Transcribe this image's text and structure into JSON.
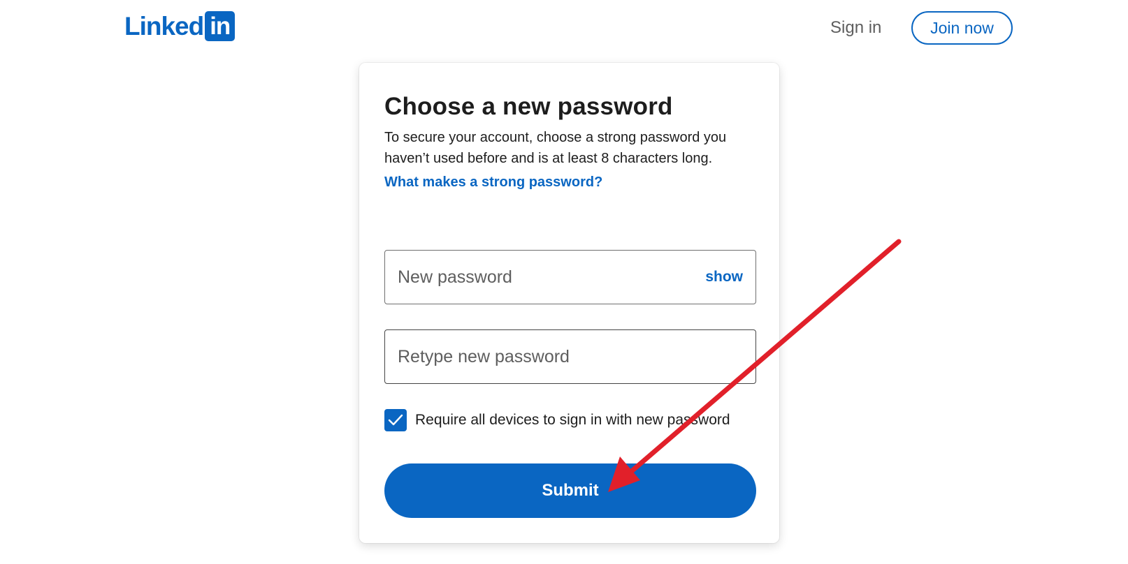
{
  "header": {
    "logo_word": "Linked",
    "logo_box": "in",
    "sign_in": "Sign in",
    "join_now": "Join now"
  },
  "card": {
    "title": "Choose a new password",
    "description": "To secure your account, choose a strong password you haven’t used before and is at least 8 characters long.",
    "help_link": "What makes a strong password?",
    "new_password": {
      "placeholder": "New password",
      "value": "",
      "show_label": "show"
    },
    "retype_password": {
      "placeholder": "Retype new password",
      "value": ""
    },
    "require_devices": {
      "label": "Require all devices to sign in with new password",
      "checked": true
    },
    "submit_label": "Submit"
  },
  "annotation": {
    "type": "arrow",
    "color": "#e1202a",
    "points_to": "submit-button"
  },
  "colors": {
    "brand": "#0a66c2",
    "annotation": "#e1202a"
  }
}
